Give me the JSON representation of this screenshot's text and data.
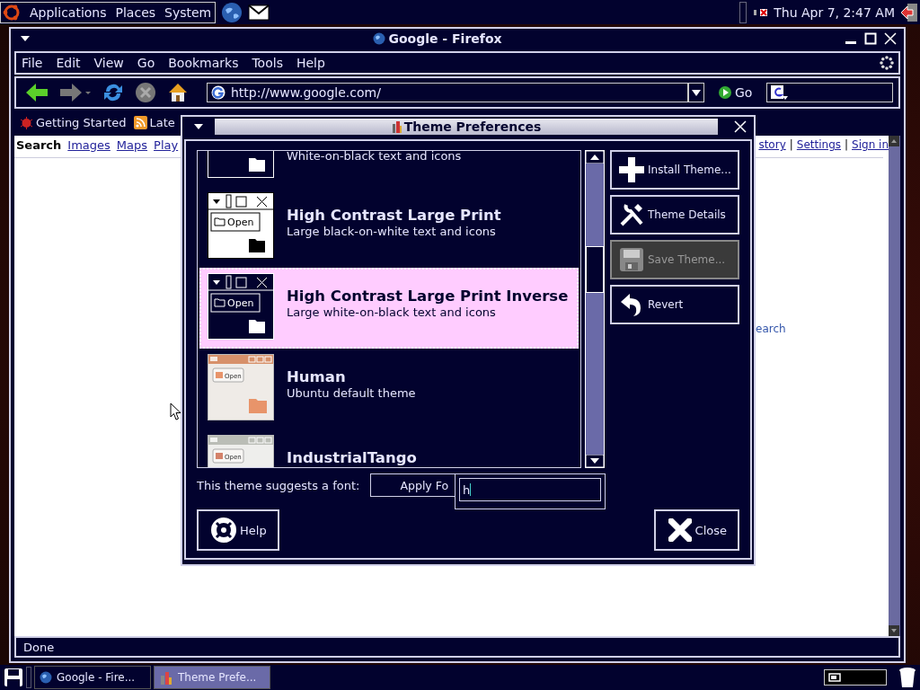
{
  "top_panel": {
    "menus": [
      "Applications",
      "Places",
      "System"
    ],
    "clock": "Thu Apr  7,  2:47 AM"
  },
  "browser": {
    "title": "Google - Firefox",
    "menus": [
      "File",
      "Edit",
      "View",
      "Go",
      "Bookmarks",
      "Tools",
      "Help"
    ],
    "url": "http://www.google.com/",
    "go": "Go",
    "bookmarks": [
      "Getting Started",
      "Late"
    ],
    "links_left": [
      {
        "label": "Search",
        "selected": true
      },
      {
        "label": "Images",
        "selected": false
      },
      {
        "label": "Maps",
        "selected": false
      },
      {
        "label": "Play",
        "selected": false
      }
    ],
    "links_right": [
      "story",
      "Settings",
      "Sign in"
    ],
    "separator": "|",
    "body_link": "earch",
    "status": "Done"
  },
  "dialog": {
    "title": "Theme Preferences",
    "themes": [
      {
        "kind": "inverse",
        "description": "White-on-black text and icons",
        "selected": false
      },
      {
        "kind": "contrast",
        "name": "High Contrast Large Print",
        "description": "Large black-on-white text and icons",
        "preview_label": "Open",
        "selected": false
      },
      {
        "kind": "inverse",
        "name": "High Contrast Large Print Inverse",
        "description": "Large white-on-black text and icons",
        "preview_label": "Open",
        "selected": true
      },
      {
        "kind": "human",
        "name": "Human",
        "description": "Ubuntu default theme",
        "preview_label": "Open",
        "selected": false
      },
      {
        "kind": "industrial",
        "name": "IndustrialTango",
        "preview_label": "Open",
        "selected": false
      }
    ],
    "side_buttons": [
      {
        "kind": "install",
        "label": "Install Theme...",
        "disabled": false
      },
      {
        "kind": "details",
        "label": "Theme Details",
        "disabled": false
      },
      {
        "kind": "save",
        "label": "Save Theme...",
        "disabled": true
      },
      {
        "kind": "revert",
        "label": "Revert",
        "disabled": false
      }
    ],
    "font_label": "This theme suggests a font:",
    "apply_button": "Apply Fo",
    "search_value": "h",
    "help_button": "Help",
    "close_button": "Close"
  },
  "taskbar": {
    "tasks": [
      {
        "label": "Google - Fire...",
        "selected": false
      },
      {
        "label": "Theme Prefe...",
        "selected": true
      }
    ]
  }
}
